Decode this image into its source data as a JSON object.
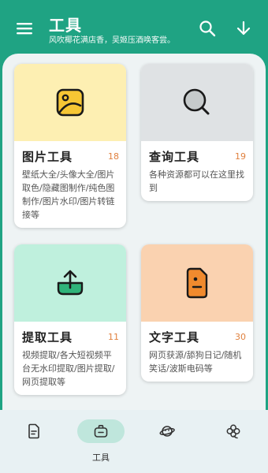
{
  "appbar": {
    "title": "工具",
    "subtitle": "风吹椰花满店香，吴姬压酒唤客尝。"
  },
  "cards": [
    {
      "title": "图片工具",
      "count": "18",
      "desc": "壁纸大全/头像大全/图片取色/隐藏图制作/纯色图制作/图片水印/图片转链接等",
      "bg": "#fdefb2",
      "icon": "image-icon"
    },
    {
      "title": "查询工具",
      "count": "19",
      "desc": "各种资源都可以在这里找到",
      "bg": "#dfe2e4",
      "icon": "search-icon"
    },
    {
      "title": "提取工具",
      "count": "11",
      "desc": "视频提取/各大短视频平台无水印提取/图片提取/网页提取等",
      "bg": "#bff0dd",
      "icon": "upload-icon"
    },
    {
      "title": "文字工具",
      "count": "30",
      "desc": "网页获源/舔狗日记/随机笑话/波斯电码等",
      "bg": "#fad2b0",
      "icon": "document-icon"
    }
  ],
  "bottom_nav": {
    "active_label": "工具",
    "items": [
      "document-icon",
      "toolbox-icon",
      "planet-icon",
      "clover-icon"
    ]
  },
  "colors": {
    "primary": "#1fa383",
    "count": "#e0813f",
    "nav_active": "#bfe6dc"
  }
}
